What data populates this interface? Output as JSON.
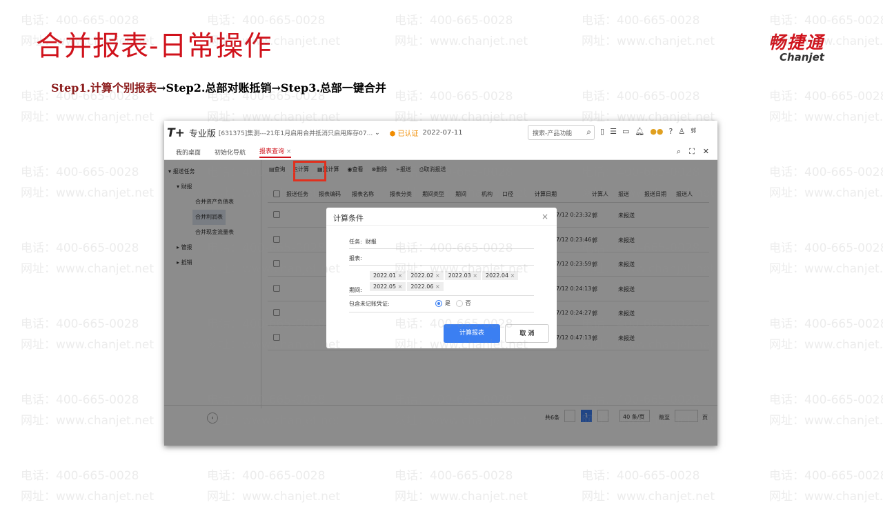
{
  "slide": {
    "title": "合并报表-日常操作",
    "step1": "Step1.计算个别报表",
    "step2": "→Step2.总部对账抵销",
    "step3": "→Step3.总部一键合并"
  },
  "logo": {
    "cn": "畅捷通",
    "en": "Chanjet"
  },
  "watermark": {
    "phone": "电话：400-665-0028",
    "site": "网址：www.chanjet.net"
  },
  "app": {
    "brand": "T+",
    "edition": "专业版",
    "account": "[631375]集测---21年1月启用合并抵消只启用库存07...",
    "cert": "已认证",
    "date": "2022-07-11",
    "search_placeholder": "搜索-产品功能",
    "user": "郭",
    "tabs": [
      "我的桌面",
      "初始化导航",
      "报表查询"
    ],
    "tree": {
      "root": "报送任务",
      "cw": "财报",
      "items": [
        "合并资产负债表",
        "合并利润表",
        "合并现金流量表"
      ],
      "gb": "管报",
      "dx": "抵销"
    },
    "toolbar": [
      "查询",
      "计算",
      "重计算",
      "查看",
      "删除",
      "报送",
      "取消报送"
    ],
    "columns": [
      "报送任务",
      "报表编码",
      "报表名称",
      "报表分类",
      "期间类型",
      "期间",
      "机构",
      "口径",
      "计算日期",
      "计算人",
      "报送",
      "报送日期",
      "报送人"
    ],
    "rows": [
      {
        "date": "7/12 0:23:32",
        "user": "郭",
        "status": "未报送"
      },
      {
        "date": "7/12 0:23:46",
        "user": "郭",
        "status": "未报送"
      },
      {
        "date": "7/12 0:23:59",
        "user": "郭",
        "status": "未报送"
      },
      {
        "date": "7/12 0:24:13",
        "user": "郭",
        "status": "未报送"
      },
      {
        "date": "7/12 0:24:27",
        "user": "郭",
        "status": "未报送"
      },
      {
        "date": "7/12 0:47:13",
        "user": "郭",
        "status": "未报送"
      }
    ],
    "pager": {
      "total": "共6条",
      "page": "1",
      "size": "40 条/页",
      "goto": "跳至",
      "unit": "页"
    }
  },
  "dialog": {
    "title": "计算条件",
    "task_label": "任务:",
    "task_value": "财报",
    "report_label": "报表:",
    "period_label": "期间:",
    "periods": [
      "2022.01",
      "2022.02",
      "2022.03",
      "2022.04",
      "2022.05",
      "2022.06"
    ],
    "include_label": "包含未记账凭证:",
    "yes": "是",
    "no": "否",
    "ok": "计算报表",
    "cancel": "取 消"
  }
}
